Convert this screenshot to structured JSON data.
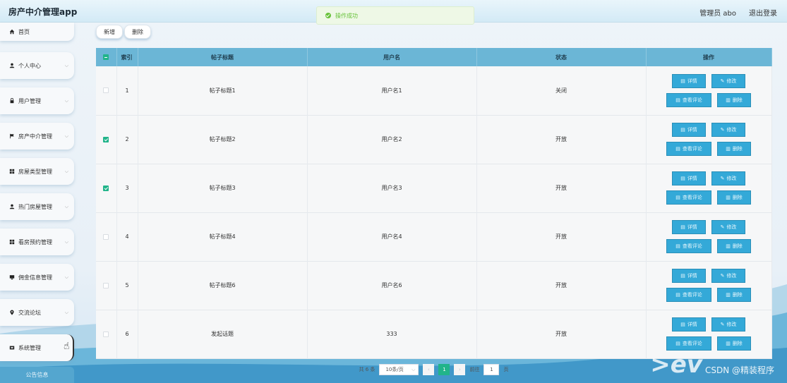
{
  "app": {
    "title": "房产中介管理app"
  },
  "header": {
    "admin": "管理员 abo",
    "logout": "退出登录"
  },
  "toast": {
    "message": "操作成功"
  },
  "sidebar": {
    "items": [
      {
        "label": "首页",
        "icon": "home-icon"
      },
      {
        "label": "个人中心",
        "icon": "user-icon"
      },
      {
        "label": "用户管理",
        "icon": "lock-icon"
      },
      {
        "label": "房产中介管理",
        "icon": "flag-icon"
      },
      {
        "label": "房屋类型管理",
        "icon": "grid-icon"
      },
      {
        "label": "热门房屋管理",
        "icon": "user-icon"
      },
      {
        "label": "看房预约管理",
        "icon": "grid-icon"
      },
      {
        "label": "佣金信息管理",
        "icon": "monitor-icon"
      },
      {
        "label": "交流论坛",
        "icon": "pin-icon"
      },
      {
        "label": "系统管理",
        "icon": "tools-icon"
      }
    ],
    "notice": "公告信息"
  },
  "toolbar": {
    "add": "新增",
    "delete": "删除"
  },
  "table": {
    "columns": [
      "索引",
      "帖子标题",
      "用户名",
      "状态",
      "操作"
    ],
    "rows": [
      {
        "index": "1",
        "title": "帖子标题1",
        "user": "用户名1",
        "status": "关闭",
        "checked": false
      },
      {
        "index": "2",
        "title": "帖子标题2",
        "user": "用户名2",
        "status": "开放",
        "checked": true
      },
      {
        "index": "3",
        "title": "帖子标题3",
        "user": "用户名3",
        "status": "开放",
        "checked": true
      },
      {
        "index": "4",
        "title": "帖子标题4",
        "user": "用户名4",
        "status": "开放",
        "checked": false
      },
      {
        "index": "5",
        "title": "帖子标题6",
        "user": "用户名6",
        "status": "开放",
        "checked": false
      },
      {
        "index": "6",
        "title": "发起话题",
        "user": "333",
        "status": "开放",
        "checked": false
      }
    ],
    "actions": {
      "detail": "详情",
      "edit": "修改",
      "comments": "查看评论",
      "delete": "删除"
    }
  },
  "pagination": {
    "total": "共 6 条",
    "page_size": "10条/页",
    "current_page": "1",
    "goto_label": "前往",
    "goto_value": "1",
    "page_suffix": "页"
  },
  "watermark": "CSDN @精装程序",
  "colors": {
    "header_bg": "#6bb6d6",
    "button": "#34a9d8",
    "accent": "#21b48a",
    "toast_text": "#67c23a"
  }
}
